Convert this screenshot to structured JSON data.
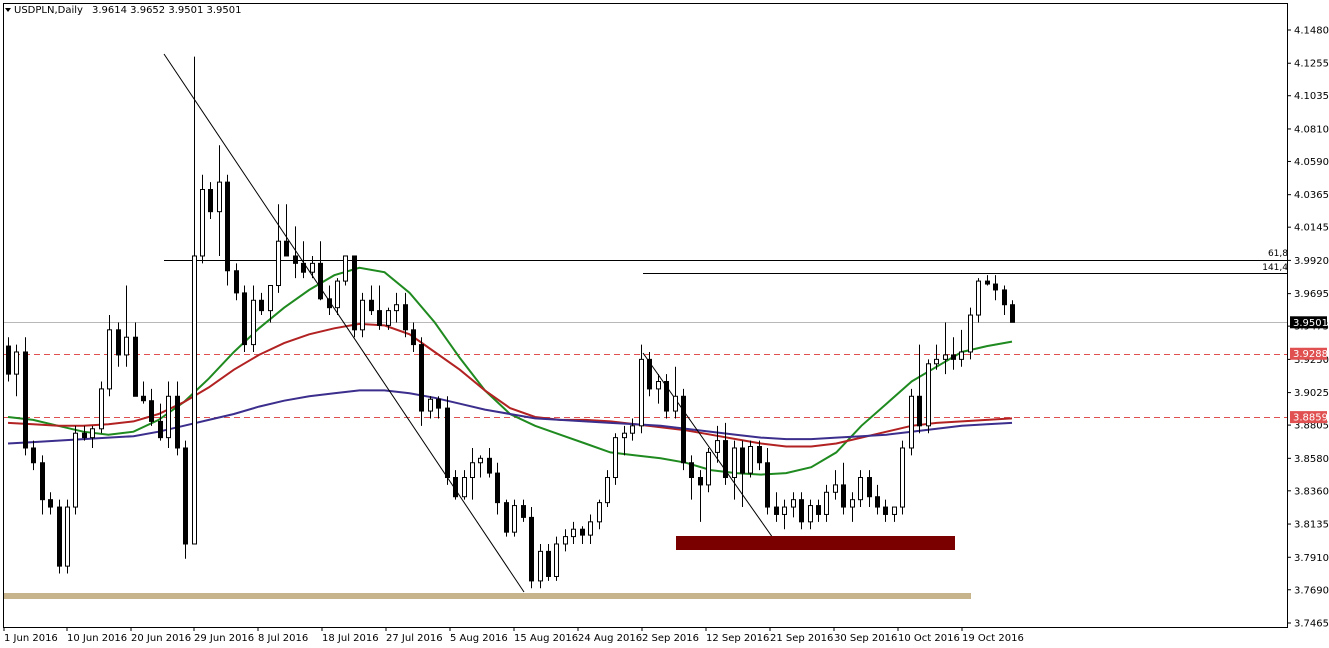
{
  "header": {
    "symbol": "USDPLN,Daily",
    "ohlc": "3.9614 3.9652 3.9501 3.9501"
  },
  "price_tags": {
    "current": "3.9501",
    "level_upper": "3.9288",
    "level_lower": "3.8859"
  },
  "fibo_labels": {
    "retracement": "61,8",
    "extension": "141,4"
  },
  "colors": {
    "bull_candle": "#ffffff",
    "bear_candle": "#000000",
    "ma_fast": "#1f8a1f",
    "ma_mid": "#b22222",
    "ma_slow": "#3b2e8c",
    "dashed_levels": "#e05050",
    "support_box": "#7a0000",
    "bottom_band": "#c8b48c",
    "current_price_tag": "#000000"
  },
  "chart_data": {
    "type": "candlestick",
    "title": "USDPLN,Daily",
    "ylim": [
      3.7465,
      4.1705
    ],
    "y_ticks": [
      "4.1480",
      "4.1255",
      "4.1035",
      "4.0810",
      "4.0590",
      "4.0365",
      "4.0145",
      "3.9920",
      "3.9695",
      "3.9475",
      "3.9250",
      "3.9025",
      "3.8805",
      "3.8580",
      "3.8360",
      "3.8135",
      "3.7910",
      "3.7690",
      "3.7465"
    ],
    "x_ticks": [
      "1 Jun 2016",
      "10 Jun 2016",
      "20 Jun 2016",
      "29 Jun 2016",
      "8 Jul 2016",
      "18 Jul 2016",
      "27 Jul 2016",
      "5 Aug 2016",
      "15 Aug 2016",
      "24 Aug 2016",
      "2 Sep 2016",
      "12 Sep 2016",
      "21 Sep 2016",
      "30 Sep 2016",
      "10 Oct 2016",
      "19 Oct 2016"
    ],
    "candles": [
      [
        3.934,
        3.94,
        3.91,
        3.915
      ],
      [
        3.915,
        3.935,
        3.9,
        3.93
      ],
      [
        3.93,
        3.94,
        3.86,
        3.865
      ],
      [
        3.865,
        3.87,
        3.85,
        3.855
      ],
      [
        3.855,
        3.86,
        3.82,
        3.83
      ],
      [
        3.83,
        3.835,
        3.82,
        3.825
      ],
      [
        3.825,
        3.83,
        3.78,
        3.785
      ],
      [
        3.785,
        3.83,
        3.78,
        3.825
      ],
      [
        3.825,
        3.88,
        3.82,
        3.875
      ],
      [
        3.875,
        3.88,
        3.87,
        3.872
      ],
      [
        3.872,
        3.88,
        3.865,
        3.878
      ],
      [
        3.878,
        3.91,
        3.875,
        3.905
      ],
      [
        3.905,
        3.955,
        3.9,
        3.945
      ],
      [
        3.945,
        3.95,
        3.92,
        3.928
      ],
      [
        3.928,
        3.975,
        3.92,
        3.94
      ],
      [
        3.94,
        3.95,
        3.91,
        3.9
      ],
      [
        3.9,
        3.91,
        3.895,
        3.897
      ],
      [
        3.897,
        3.905,
        3.88,
        3.883
      ],
      [
        3.883,
        3.895,
        3.87,
        3.872
      ],
      [
        3.872,
        3.91,
        3.865,
        3.9
      ],
      [
        3.9,
        3.91,
        3.86,
        3.865
      ],
      [
        3.865,
        3.87,
        3.79,
        3.8
      ],
      [
        3.8,
        4.13,
        3.8,
        3.995
      ],
      [
        3.995,
        4.05,
        3.99,
        4.04
      ],
      [
        4.04,
        4.045,
        4.02,
        4.025
      ],
      [
        4.025,
        4.07,
        3.995,
        4.045
      ],
      [
        4.045,
        4.05,
        3.975,
        3.985
      ],
      [
        3.985,
        3.99,
        3.965,
        3.97
      ],
      [
        3.97,
        3.975,
        3.93,
        3.935
      ],
      [
        3.935,
        3.975,
        3.93,
        3.965
      ],
      [
        3.965,
        3.97,
        3.955,
        3.958
      ],
      [
        3.958,
        3.975,
        3.95,
        3.975
      ],
      [
        3.975,
        4.03,
        3.97,
        4.005
      ],
      [
        4.005,
        4.03,
        3.995,
        3.995
      ],
      [
        3.995,
        4.015,
        3.98,
        3.99
      ],
      [
        3.99,
        4.005,
        3.98,
        3.984
      ],
      [
        3.984,
        3.995,
        3.98,
        3.99
      ],
      [
        3.99,
        4.005,
        3.965,
        3.966
      ],
      [
        3.966,
        3.975,
        3.955,
        3.96
      ],
      [
        3.96,
        3.98,
        3.955,
        3.978
      ],
      [
        3.978,
        3.995,
        3.975,
        3.995
      ],
      [
        3.995,
        3.995,
        3.94,
        3.945
      ],
      [
        3.945,
        3.97,
        3.94,
        3.965
      ],
      [
        3.965,
        3.975,
        3.955,
        3.958
      ],
      [
        3.958,
        3.975,
        3.945,
        3.948
      ],
      [
        3.948,
        3.96,
        3.945,
        3.958
      ],
      [
        3.958,
        3.97,
        3.95,
        3.962
      ],
      [
        3.962,
        3.97,
        3.94,
        3.945
      ],
      [
        3.945,
        3.95,
        3.93,
        3.935
      ],
      [
        3.935,
        3.94,
        3.88,
        3.89
      ],
      [
        3.89,
        3.9,
        3.885,
        3.898
      ],
      [
        3.898,
        3.9,
        3.885,
        3.892
      ],
      [
        3.892,
        3.9,
        3.84,
        3.845
      ],
      [
        3.845,
        3.85,
        3.83,
        3.832
      ],
      [
        3.832,
        3.85,
        3.83,
        3.845
      ],
      [
        3.845,
        3.865,
        3.83,
        3.855
      ],
      [
        3.855,
        3.86,
        3.845,
        3.858
      ],
      [
        3.858,
        3.865,
        3.845,
        3.848
      ],
      [
        3.848,
        3.855,
        3.82,
        3.828
      ],
      [
        3.828,
        3.83,
        3.805,
        3.808
      ],
      [
        3.808,
        3.83,
        3.805,
        3.826
      ],
      [
        3.826,
        3.83,
        3.815,
        3.818
      ],
      [
        3.818,
        3.825,
        3.77,
        3.775
      ],
      [
        3.775,
        3.8,
        3.77,
        3.795
      ],
      [
        3.795,
        3.8,
        3.775,
        3.778
      ],
      [
        3.778,
        3.805,
        3.775,
        3.8
      ],
      [
        3.8,
        3.81,
        3.795,
        3.805
      ],
      [
        3.805,
        3.815,
        3.8,
        3.81
      ],
      [
        3.81,
        3.812,
        3.8,
        3.806
      ],
      [
        3.806,
        3.82,
        3.8,
        3.815
      ],
      [
        3.815,
        3.83,
        3.81,
        3.828
      ],
      [
        3.828,
        3.85,
        3.825,
        3.845
      ],
      [
        3.845,
        3.875,
        3.84,
        3.872
      ],
      [
        3.872,
        3.88,
        3.86,
        3.875
      ],
      [
        3.875,
        3.885,
        3.87,
        3.88
      ],
      [
        3.88,
        3.935,
        3.875,
        3.925
      ],
      [
        3.925,
        3.93,
        3.9,
        3.905
      ],
      [
        3.905,
        3.915,
        3.895,
        3.91
      ],
      [
        3.91,
        3.915,
        3.885,
        3.89
      ],
      [
        3.89,
        3.92,
        3.885,
        3.9
      ],
      [
        3.9,
        3.905,
        3.85,
        3.855
      ],
      [
        3.855,
        3.86,
        3.83,
        3.845
      ],
      [
        3.845,
        3.85,
        3.815,
        3.84
      ],
      [
        3.84,
        3.865,
        3.835,
        3.862
      ],
      [
        3.862,
        3.88,
        3.855,
        3.87
      ],
      [
        3.87,
        3.882,
        3.84,
        3.845
      ],
      [
        3.845,
        3.87,
        3.83,
        3.865
      ],
      [
        3.865,
        3.87,
        3.825,
        3.848
      ],
      [
        3.848,
        3.87,
        3.845,
        3.866
      ],
      [
        3.866,
        3.87,
        3.85,
        3.855
      ],
      [
        3.855,
        3.865,
        3.82,
        3.825
      ],
      [
        3.825,
        3.835,
        3.815,
        3.82
      ],
      [
        3.82,
        3.83,
        3.81,
        3.825
      ],
      [
        3.825,
        3.835,
        3.818,
        3.83
      ],
      [
        3.83,
        3.835,
        3.81,
        3.815
      ],
      [
        3.815,
        3.83,
        3.81,
        3.826
      ],
      [
        3.826,
        3.83,
        3.815,
        3.82
      ],
      [
        3.82,
        3.84,
        3.815,
        3.835
      ],
      [
        3.835,
        3.85,
        3.83,
        3.84
      ],
      [
        3.84,
        3.855,
        3.82,
        3.825
      ],
      [
        3.825,
        3.835,
        3.815,
        3.83
      ],
      [
        3.83,
        3.85,
        3.825,
        3.845
      ],
      [
        3.845,
        3.85,
        3.825,
        3.832
      ],
      [
        3.832,
        3.84,
        3.82,
        3.825
      ],
      [
        3.825,
        3.83,
        3.815,
        3.82
      ],
      [
        3.82,
        3.825,
        3.815,
        3.825
      ],
      [
        3.825,
        3.87,
        3.82,
        3.865
      ],
      [
        3.865,
        3.905,
        3.86,
        3.9
      ],
      [
        3.9,
        3.935,
        3.875,
        3.88
      ],
      [
        3.88,
        3.925,
        3.875,
        3.922
      ],
      [
        3.922,
        3.935,
        3.918,
        3.925
      ],
      [
        3.925,
        3.95,
        3.915,
        3.928
      ],
      [
        3.928,
        3.94,
        3.918,
        3.925
      ],
      [
        3.925,
        3.945,
        3.92,
        3.93
      ],
      [
        3.93,
        3.96,
        3.925,
        3.955
      ],
      [
        3.955,
        3.98,
        3.95,
        3.978
      ],
      [
        3.978,
        3.982,
        3.975,
        3.976
      ],
      [
        3.976,
        3.982,
        3.965,
        3.972
      ],
      [
        3.972,
        3.975,
        3.955,
        3.962
      ],
      [
        3.962,
        3.965,
        3.95,
        3.9501
      ]
    ],
    "moving_averages": [
      {
        "color": "#1f8a1f",
        "values": [
          3.886,
          3.884,
          3.88,
          3.876,
          3.874,
          3.876,
          3.884,
          3.896,
          3.912,
          3.93,
          3.946,
          3.96,
          3.972,
          3.982,
          3.987,
          3.984,
          3.97,
          3.95,
          3.926,
          3.904,
          3.888,
          3.88,
          3.874,
          3.868,
          3.862,
          3.86,
          3.858,
          3.855,
          3.85,
          3.848,
          3.847,
          3.848,
          3.852,
          3.862,
          3.88,
          3.895,
          3.91,
          3.92,
          3.93,
          3.934,
          3.937
        ]
      },
      {
        "color": "#b22222",
        "values": [
          3.882,
          3.881,
          3.88,
          3.88,
          3.881,
          3.883,
          3.888,
          3.896,
          3.906,
          3.918,
          3.928,
          3.936,
          3.942,
          3.946,
          3.949,
          3.948,
          3.942,
          3.93,
          3.918,
          3.904,
          3.892,
          3.886,
          3.884,
          3.884,
          3.883,
          3.881,
          3.879,
          3.877,
          3.874,
          3.871,
          3.868,
          3.866,
          3.866,
          3.868,
          3.872,
          3.876,
          3.88,
          3.882,
          3.883,
          3.884,
          3.885
        ]
      },
      {
        "color": "#3b2e8c",
        "values": [
          3.868,
          3.869,
          3.87,
          3.871,
          3.872,
          3.873,
          3.876,
          3.88,
          3.884,
          3.888,
          3.893,
          3.897,
          3.9,
          3.902,
          3.904,
          3.904,
          3.902,
          3.899,
          3.895,
          3.891,
          3.888,
          3.885,
          3.884,
          3.883,
          3.882,
          3.881,
          3.88,
          3.878,
          3.876,
          3.874,
          3.872,
          3.871,
          3.871,
          3.872,
          3.873,
          3.874,
          3.876,
          3.878,
          3.88,
          3.881,
          3.882
        ]
      }
    ],
    "horizontal_levels": [
      {
        "price": 3.9501,
        "style": "solid-gray"
      },
      {
        "price": 3.9288,
        "style": "dashed-red"
      },
      {
        "price": 3.8859,
        "style": "dashed-red"
      }
    ]
  }
}
